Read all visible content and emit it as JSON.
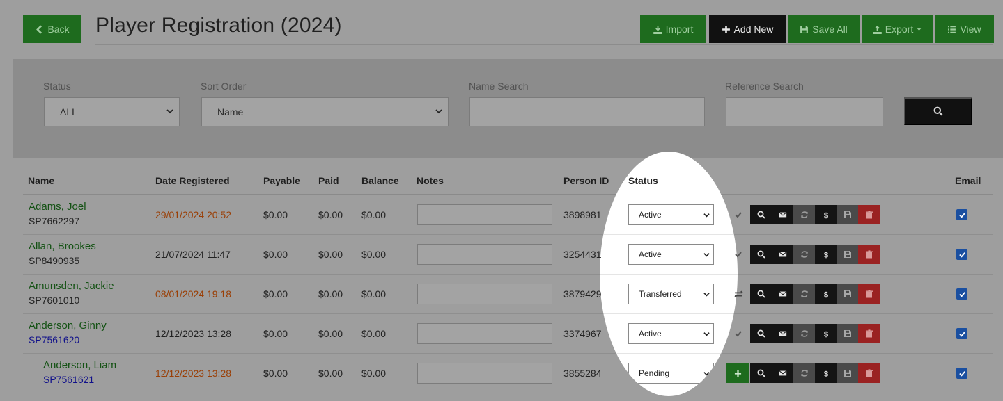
{
  "header": {
    "back_label": "Back",
    "title": "Player Registration (2024)",
    "import_label": "Import",
    "add_new_label": "Add New",
    "save_all_label": "Save All",
    "export_label": "Export",
    "view_label": "View"
  },
  "filters": {
    "status_label": "Status",
    "status_value": "ALL",
    "sort_label": "Sort Order",
    "sort_value": "Name",
    "name_search_label": "Name Search",
    "reference_search_label": "Reference Search"
  },
  "table": {
    "columns": {
      "name": "Name",
      "date": "Date Registered",
      "payable": "Payable",
      "paid": "Paid",
      "balance": "Balance",
      "notes": "Notes",
      "person_id": "Person ID",
      "status": "Status",
      "email": "Email"
    },
    "rows": [
      {
        "name": "Adams, Joel",
        "ref": "SP7662297",
        "date": "29/01/2024 20:52",
        "payable": "$0.00",
        "paid": "$0.00",
        "balance": "$0.00",
        "person_id": "3898981",
        "status": "Active",
        "state_icon": "check-icon",
        "email_checked": true
      },
      {
        "name": "Allan, Brookes",
        "ref": "SP8490935",
        "date": "21/07/2024 11:47",
        "payable": "$0.00",
        "paid": "$0.00",
        "balance": "$0.00",
        "person_id": "3254431",
        "status": "Active",
        "state_icon": "check-icon",
        "email_checked": true
      },
      {
        "name": "Amunsden, Jackie",
        "ref": "SP7601010",
        "date": "08/01/2024 19:18",
        "payable": "$0.00",
        "paid": "$0.00",
        "balance": "$0.00",
        "person_id": "3879429",
        "status": "Transferred",
        "state_icon": "transfer-icon",
        "email_checked": true
      },
      {
        "name": "Anderson, Ginny",
        "ref": "SP7561620",
        "date": "12/12/2023 13:28",
        "payable": "$0.00",
        "paid": "$0.00",
        "balance": "$0.00",
        "person_id": "3374967",
        "status": "Active",
        "state_icon": "check-icon",
        "email_checked": true
      },
      {
        "name": "Anderson, Liam",
        "ref": "SP7561621",
        "date": "12/12/2023 13:28",
        "payable": "$0.00",
        "paid": "$0.00",
        "balance": "$0.00",
        "person_id": "3855284",
        "status": "Pending",
        "state_icon": "plus-icon",
        "email_checked": true
      }
    ]
  },
  "colors": {
    "green_button": "#1e6b1e",
    "black_button": "#111111",
    "delete_red": "#9a2222",
    "date_highlight": "#9a3f06",
    "checkbox": "#1a4fa0"
  }
}
